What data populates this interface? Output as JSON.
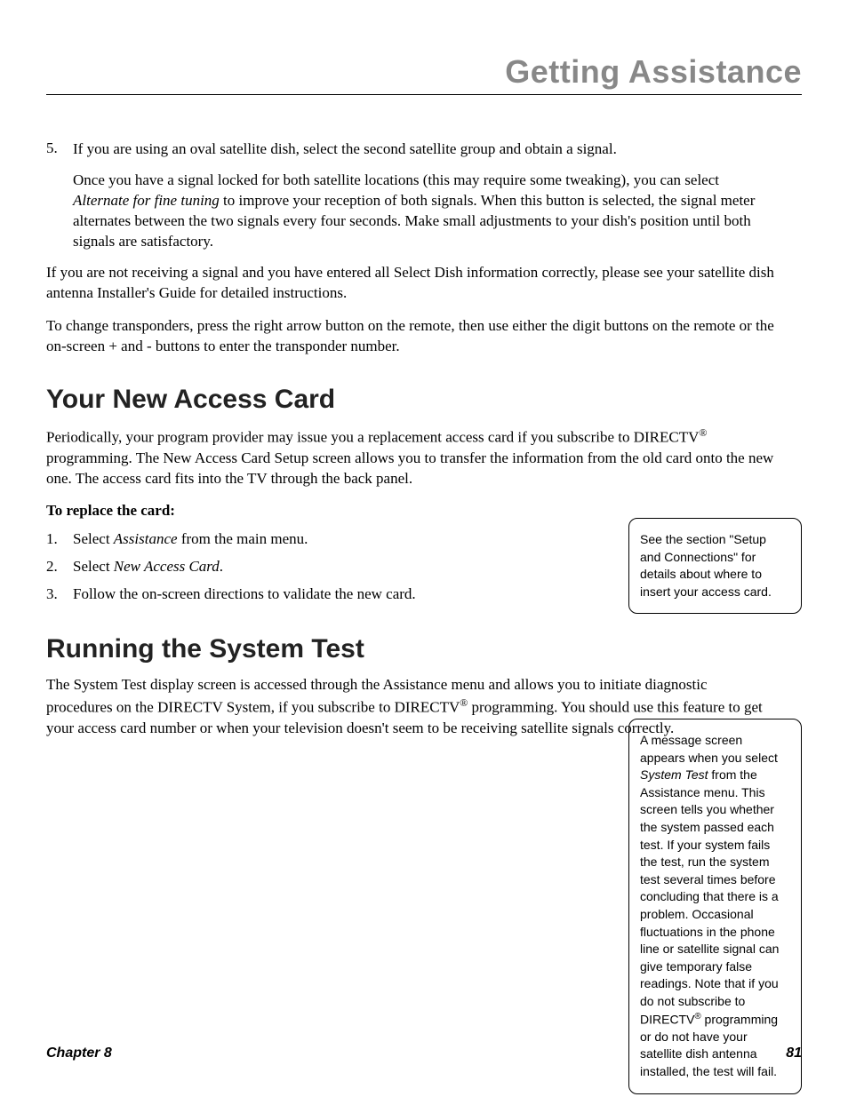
{
  "header": {
    "title": "Getting Assistance"
  },
  "step5": {
    "number": "5.",
    "para1": "If you are using an oval satellite dish, select the second satellite group and obtain a signal.",
    "para2_a": "Once you have a signal locked for both satellite locations (this may require some tweaking), you can select ",
    "para2_italic": "Alternate for fine tuning",
    "para2_b": " to improve your reception of both signals. When this button is selected, the signal meter alternates between the two signals every four seconds. Make small adjustments to your dish's position until both signals are satisfactory."
  },
  "para_after1": "If you are not receiving a signal and you have entered all Select Dish information correctly, please see your satellite dish antenna Installer's Guide for detailed instructions.",
  "para_after2": "To change transponders, press the right arrow button on the remote, then use either the digit buttons on the remote or the on-screen + and - buttons to enter the transponder number.",
  "section1": {
    "heading": "Your New Access Card",
    "intro_a": "Periodically, your program provider may issue you a replacement access card if you subscribe to DIRECTV",
    "intro_sup": "®",
    "intro_b": " programming. The New Access Card Setup screen allows you to transfer the information from the old card onto the new one. The access card fits into the TV through the back panel.",
    "replace_label": "To replace the card:",
    "steps": {
      "s1_num": "1.",
      "s1_a": "Select ",
      "s1_i": "Assistance",
      "s1_b": " from the main menu.",
      "s2_num": "2.",
      "s2_a": "Select ",
      "s2_i": "New Access Card",
      "s2_b": ".",
      "s3_num": "3.",
      "s3_text": "Follow the on-screen directions to validate the new card."
    }
  },
  "section2": {
    "heading": "Running the System Test",
    "para_a": "The System Test display screen is accessed through the Assistance menu and allows you to initiate diagnostic procedures on the DIRECTV System, if you subscribe to DIRECTV",
    "para_sup": "®",
    "para_b": " programming. You should use this feature to get your access card number or when your television doesn't seem to be receiving satellite signals correctly."
  },
  "callout1": "See the section \"Setup and Connections\" for details about where to insert your access card.",
  "callout2_a": "A message screen appears when you select ",
  "callout2_i": "System Test",
  "callout2_b": " from the Assistance menu. This screen tells you whether the system passed each test. If your system fails the test, run the system test several times before concluding that there is a problem. Occasional fluctuations in the phone line or satellite signal can give temporary false readings.  Note that if you do not subscribe to DIRECTV",
  "callout2_sup": "®",
  "callout2_c": " programming or do not have your satellite dish antenna installed, the test will fail.",
  "footer": {
    "chapter": "Chapter 8",
    "page": "81"
  }
}
